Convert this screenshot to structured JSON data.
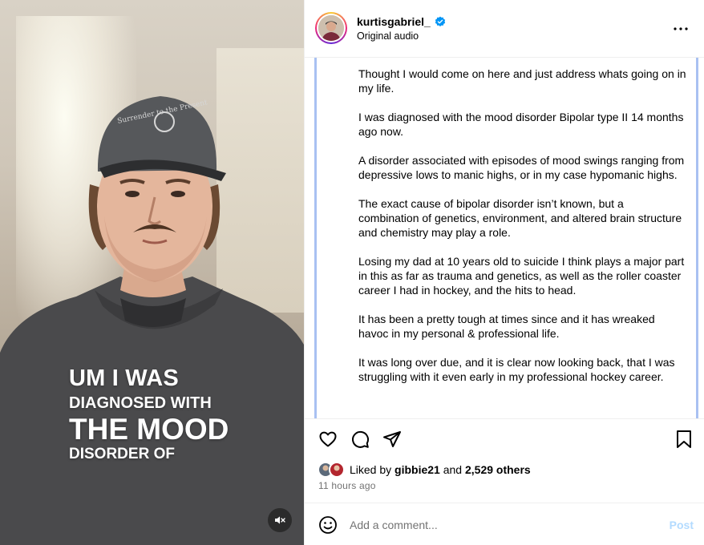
{
  "video": {
    "overlay_caption": {
      "line1": "UM I WAS",
      "line2": "DIAGNOSED WITH",
      "line3": "THE MOOD",
      "line4": "DISORDER OF"
    },
    "hat_text": "Surrender to the Present",
    "mute_icon": "speaker-muted-icon"
  },
  "header": {
    "username": "kurtisgabriel_",
    "verified": true,
    "audio": "Original audio",
    "more_icon": "more-horizontal-icon"
  },
  "post": {
    "paragraphs": [
      "Thought I would come on here and just address whats going on in my life.",
      "I was diagnosed with the mood disorder Bipolar type II 14 months ago now.",
      "A disorder associated with episodes of mood swings ranging from depressive lows to manic highs, or in my case hypomanic highs.",
      "The exact cause of bipolar disorder isn’t known, but a combination of genetics, environment, and altered brain structure and chemistry may play a role.",
      "Losing my dad at 10 years old to suicide I think plays a major part in this as far as trauma and genetics, as well as the roller coaster career I had in hockey, and the hits to head.",
      "It has been a pretty tough at times since and it has wreaked havoc in my personal & professional life.",
      "It was long over due, and it is clear now looking back, that I was struggling with it even early in my professional hockey career."
    ]
  },
  "actions": {
    "like_icon": "heart-icon",
    "comment_icon": "comment-icon",
    "share_icon": "share-icon",
    "save_icon": "bookmark-icon"
  },
  "likes": {
    "prefix": "Liked by",
    "user": "gibbie21",
    "conjunction": "and",
    "others": "2,529 others"
  },
  "timestamp": "11 hours ago",
  "comment": {
    "placeholder": "Add a comment...",
    "post_label": "Post"
  },
  "colors": {
    "verified_blue": "#0095f6",
    "post_button_disabled": "#b3dbff",
    "scrollbar_accent": "#a9c1f2"
  }
}
